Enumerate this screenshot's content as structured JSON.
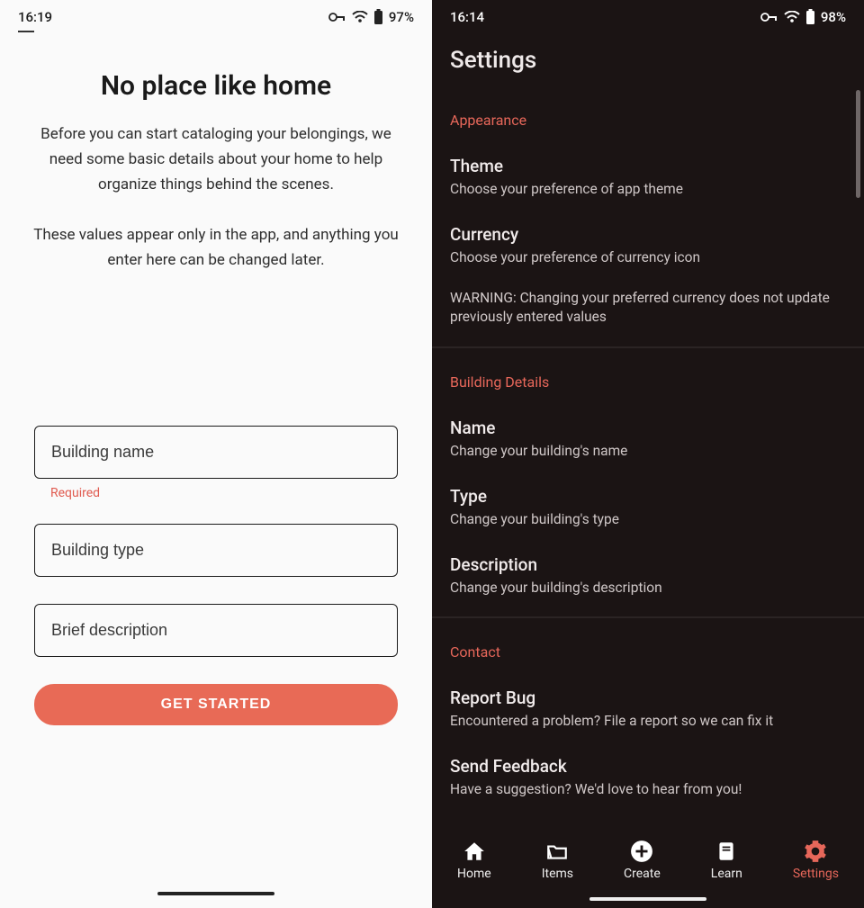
{
  "left": {
    "status": {
      "time": "16:19",
      "battery": "97%"
    },
    "title": "No place like home",
    "para1": "Before you can start cataloging your belongings, we need some basic details about your home to help organize things behind the scenes.",
    "para2": "These values appear only in the app, and anything you enter here can be changed later.",
    "fields": {
      "name_placeholder": "Building name",
      "name_required": "Required",
      "type_placeholder": "Building type",
      "desc_placeholder": "Brief description"
    },
    "cta": "GET STARTED"
  },
  "right": {
    "status": {
      "time": "16:14",
      "battery": "98%"
    },
    "title": "Settings",
    "sections": {
      "appearance": {
        "head": "Appearance",
        "theme": {
          "title": "Theme",
          "sub": "Choose your preference of app theme"
        },
        "currency": {
          "title": "Currency",
          "sub": "Choose your preference of currency icon"
        },
        "warning": "WARNING: Changing your preferred currency does not update previously entered values"
      },
      "building": {
        "head": "Building Details",
        "name": {
          "title": "Name",
          "sub": "Change your building's name"
        },
        "type": {
          "title": "Type",
          "sub": "Change your building's type"
        },
        "desc": {
          "title": "Description",
          "sub": "Change your building's description"
        }
      },
      "contact": {
        "head": "Contact",
        "bug": {
          "title": "Report Bug",
          "sub": "Encountered a problem? File a report so we can fix it"
        },
        "feedback": {
          "title": "Send Feedback",
          "sub": "Have a suggestion? We'd love to hear from you!"
        }
      }
    },
    "nav": {
      "home": "Home",
      "items": "Items",
      "create": "Create",
      "learn": "Learn",
      "settings": "Settings"
    }
  }
}
